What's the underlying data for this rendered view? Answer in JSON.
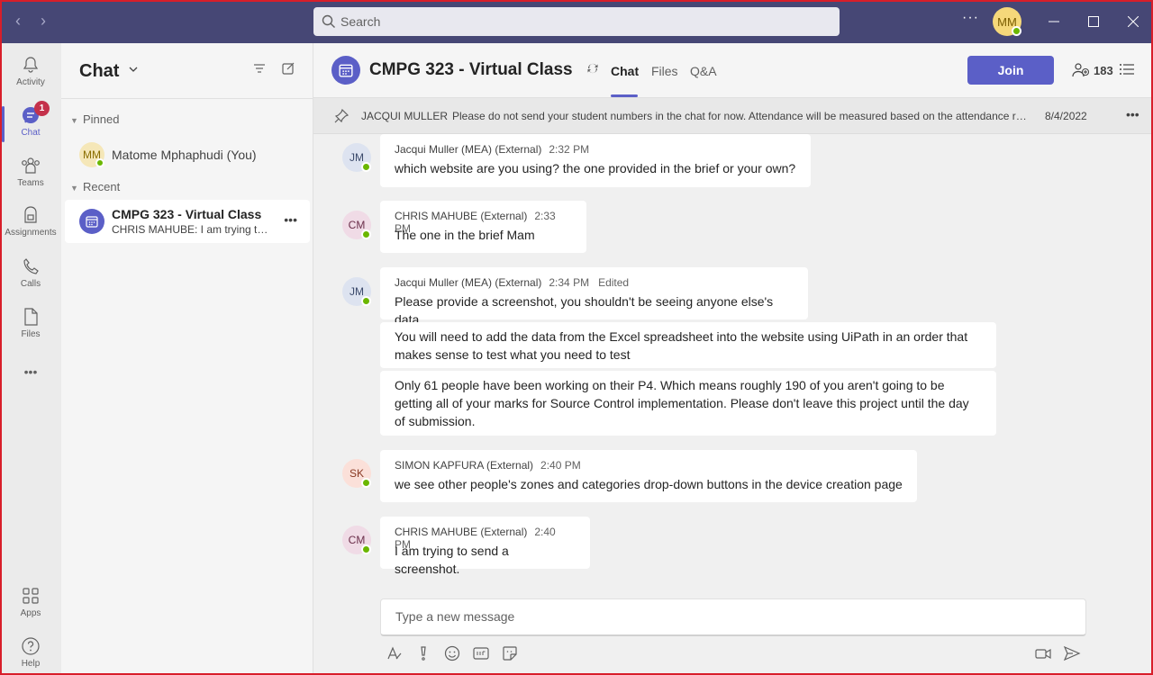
{
  "titlebar": {
    "search_placeholder": "Search",
    "user_initials": "MM",
    "more_label": "···"
  },
  "rail": {
    "items": [
      {
        "label": "Activity",
        "icon": "bell-icon"
      },
      {
        "label": "Chat",
        "icon": "chat-icon",
        "badge": "1"
      },
      {
        "label": "Teams",
        "icon": "teams-icon"
      },
      {
        "label": "Assignments",
        "icon": "assignments-icon"
      },
      {
        "label": "Calls",
        "icon": "phone-icon"
      },
      {
        "label": "Files",
        "icon": "file-icon"
      },
      {
        "label": "Apps",
        "icon": "apps-icon"
      },
      {
        "label": "Help",
        "icon": "help-icon"
      }
    ]
  },
  "panel": {
    "title": "Chat",
    "pinned_label": "Pinned",
    "recent_label": "Recent",
    "pinned_contact": {
      "initials": "MM",
      "name": "Matome Mphaphudi (You)"
    },
    "recent_chat": {
      "title": "CMPG 323 - Virtual Class",
      "preview": "CHRIS MAHUBE: I am trying to send a screenshot."
    }
  },
  "header": {
    "title": "CMPG 323 - Virtual Class",
    "tabs": [
      "Chat",
      "Files",
      "Q&A"
    ],
    "join_label": "Join",
    "participant_count": "183"
  },
  "pinned_message": {
    "author": "JACQUI MULLER",
    "text": "Please do not send your student numbers in the chat for now. Attendance will be measured based on the attendance register.",
    "date": "8/4/2022"
  },
  "messages": [
    {
      "initials": "JM",
      "author": "Jacqui Muller (MEA) (External)",
      "time": "2:32 PM",
      "edited": "",
      "text": "which website are you using? the one provided in the brief or your own?"
    },
    {
      "initials": "CM",
      "author": "CHRIS MAHUBE (External)",
      "time": "2:33 PM",
      "edited": "",
      "text": "The one in the brief Mam"
    },
    {
      "initials": "JM",
      "author": "Jacqui Muller (MEA) (External)",
      "time": "2:34 PM",
      "edited": "Edited",
      "text": "Please provide a screenshot, you shouldn't be seeing anyone else's data"
    },
    {
      "initials": "",
      "author": "",
      "time": "",
      "edited": "",
      "text": "You will need to add the data from the Excel spreadsheet into the website using UiPath in an order that makes sense to test what you need to test"
    },
    {
      "initials": "",
      "author": "",
      "time": "",
      "edited": "",
      "text": "Only 61 people have been working on their P4. Which means roughly 190 of you aren't going to be getting all of your marks for Source Control implementation. Please don't leave this project until the day of submission."
    },
    {
      "initials": "SK",
      "author": "SIMON KAPFURA (External)",
      "time": "2:40 PM",
      "edited": "",
      "text": "we see other people's zones and categories drop-down buttons in the device creation page"
    },
    {
      "initials": "CM",
      "author": "CHRIS MAHUBE (External)",
      "time": "2:40 PM",
      "edited": "",
      "text": "I am trying to send a screenshot."
    }
  ],
  "compose": {
    "placeholder": "Type a new message"
  },
  "colors": {
    "titlebar": "#464775",
    "accent": "#5b5fc7",
    "presence": "#6bb700",
    "badge": "#c4314b"
  }
}
